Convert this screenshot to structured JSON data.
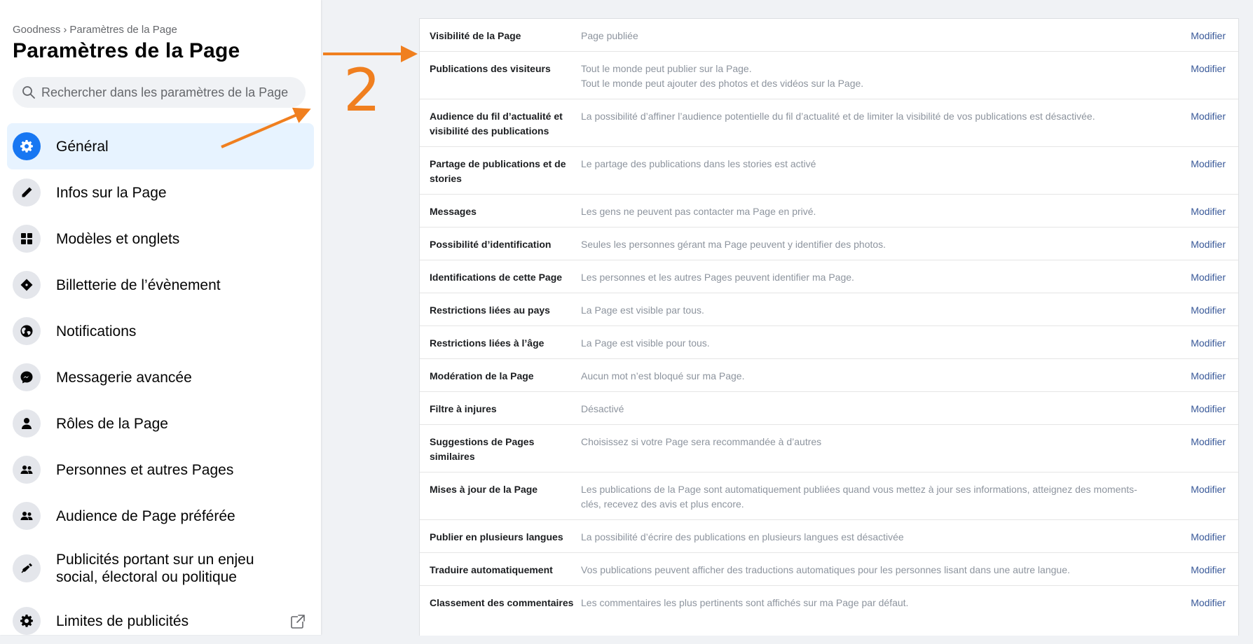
{
  "breadcrumb": {
    "page_name": "Goodness",
    "separator": "›",
    "current": "Paramètres de la Page"
  },
  "page_title": "Paramètres de la Page",
  "search": {
    "placeholder": "Rechercher dans les paramètres de la Page"
  },
  "sidebar": {
    "items": [
      {
        "label": "Général",
        "icon": "gear-icon",
        "active": true
      },
      {
        "label": "Infos sur la Page",
        "icon": "pencil-icon"
      },
      {
        "label": "Modèles et onglets",
        "icon": "grid-icon"
      },
      {
        "label": "Billetterie de l’évènement",
        "icon": "ticket-icon"
      },
      {
        "label": "Notifications",
        "icon": "globe-icon"
      },
      {
        "label": "Messagerie avancée",
        "icon": "messenger-icon"
      },
      {
        "label": "Rôles de la Page",
        "icon": "person-icon"
      },
      {
        "label": "Personnes et autres Pages",
        "icon": "people-icon"
      },
      {
        "label": "Audience de Page préférée",
        "icon": "people-icon"
      },
      {
        "label": "Publicités portant sur un enjeu social, électoral ou politique",
        "icon": "megaphone-icon"
      },
      {
        "label": "Limites de publicités",
        "icon": "gear-icon",
        "external": "external-link-icon"
      }
    ]
  },
  "annotation": {
    "number": "2",
    "color": "#f07f1f"
  },
  "settings": {
    "action_label": "Modifier",
    "rows": [
      {
        "label": "Visibilité de la Page",
        "value": "Page publiée"
      },
      {
        "label": "Publications des visiteurs",
        "value": "Tout le monde peut publier sur la Page.",
        "value2": "Tout le monde peut ajouter des photos et des vidéos sur la Page."
      },
      {
        "label": "Audience du fil d’actualité et visibilité des publications",
        "value": "La possibilité d’affiner l’audience potentielle du fil d’actualité et de limiter la visibilité de vos publications est désactivée."
      },
      {
        "label": "Partage de publications et de stories",
        "value": "Le partage des publications dans les stories est activé"
      },
      {
        "label": "Messages",
        "value": "Les gens ne peuvent pas contacter ma Page en privé."
      },
      {
        "label": "Possibilité d’identification",
        "value": "Seules les personnes gérant ma Page peuvent y identifier des photos."
      },
      {
        "label": "Identifications de cette Page",
        "value": "Les personnes et les autres Pages peuvent identifier ma Page."
      },
      {
        "label": "Restrictions liées au pays",
        "value": "La Page est visible par tous."
      },
      {
        "label": "Restrictions liées à l’âge",
        "value": "La Page est visible pour tous."
      },
      {
        "label": "Modération de la Page",
        "value": "Aucun mot n’est bloqué sur ma Page."
      },
      {
        "label": "Filtre à injures",
        "value": "Désactivé"
      },
      {
        "label": "Suggestions de Pages similaires",
        "value": "Choisissez si votre Page sera recommandée à d’autres"
      },
      {
        "label": "Mises à jour de la Page",
        "value": "Les publications de la Page sont automatiquement publiées quand vous mettez à jour ses informations, atteignez des moments-clés, recevez des avis et plus encore."
      },
      {
        "label": "Publier en plusieurs langues",
        "value": "La possibilité d’écrire des publications en plusieurs langues est désactivée"
      },
      {
        "label": "Traduire automatiquement",
        "value": "Vos publications peuvent afficher des traductions automatiques pour les personnes lisant dans une autre langue."
      },
      {
        "label": "Classement des commentaires",
        "value": "Les commentaires les plus pertinents sont affichés sur ma Page par défaut."
      }
    ]
  },
  "colors": {
    "accent": "#1877f2",
    "link": "#385898",
    "annotation": "#f07f1f"
  }
}
